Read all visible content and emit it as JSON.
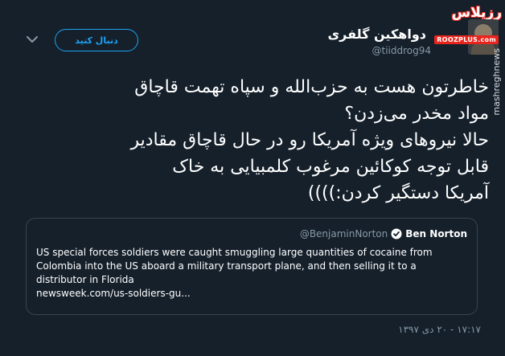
{
  "site": {
    "logo_text": "رزپلاس",
    "badge_text": "ROOZPLUS.com",
    "vertical_handle": "mashreghnews"
  },
  "author": {
    "display_name": "دواهکین گلفری",
    "handle": "@tiiddrog94"
  },
  "actions": {
    "follow_label": "دنبال کنید"
  },
  "tweet": {
    "lines": [
      "خاطرتون هست به حزب‌الله و سپاه تهمت قاچاق",
      "مواد مخدر می‌زدن؟",
      "حالا نیروهای ویژه آمریکا رو در حال قاچاق مقادیر",
      "قابل توجه کوکائین مرغوب کلمبیایی به خاک",
      "آمریکا دستگیر کردن:))))"
    ],
    "timestamp": "۱۷:۱۷ - ۲۰ دی ۱۳۹۷"
  },
  "quote": {
    "name": "Ben Norton",
    "handle": "@BenjaminNorton",
    "lines": [
      "US special forces soldiers were caught smuggling large quantities of cocaine from",
      "Colombia into the US aboard a military transport plane, and then selling it to a",
      "distributor in Florida",
      "newsweek.com/us-soldiers-gu..."
    ]
  },
  "icons": {
    "menu": "chevron-down-icon",
    "verified": "verified-badge-icon",
    "avatar": "avatar"
  },
  "colors": {
    "background": "#15202b",
    "accent": "#1da1f2",
    "muted": "#8899a6",
    "border": "#38444d",
    "logo": "#e8251d"
  }
}
